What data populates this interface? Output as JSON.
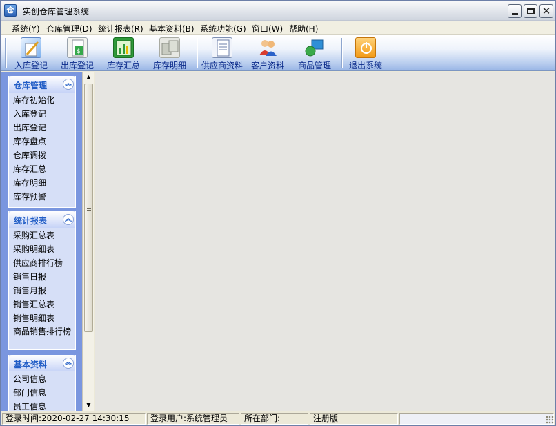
{
  "window": {
    "title": "实创仓库管理系统",
    "icon": "warehouse-app-icon"
  },
  "menu": [
    {
      "label": "系统(Y)"
    },
    {
      "label": "仓库管理(D)"
    },
    {
      "label": "统计报表(R)"
    },
    {
      "label": "基本资料(B)"
    },
    {
      "label": "系统功能(G)"
    },
    {
      "label": "窗口(W)"
    },
    {
      "label": "帮助(H)"
    }
  ],
  "toolbar": [
    {
      "label": "入库登记",
      "icon": "stock-in-icon"
    },
    {
      "label": "出库登记",
      "icon": "stock-out-icon"
    },
    {
      "label": "库存汇总",
      "icon": "inventory-summary-icon"
    },
    {
      "label": "库存明细",
      "icon": "inventory-detail-icon"
    },
    {
      "label": "供应商资料",
      "icon": "supplier-icon"
    },
    {
      "label": "客户资料",
      "icon": "customer-icon"
    },
    {
      "label": "商品管理",
      "icon": "product-icon"
    },
    {
      "label": "退出系统",
      "icon": "exit-icon"
    }
  ],
  "sidebar": {
    "groups": [
      {
        "title": "仓库管理",
        "items": [
          "库存初始化",
          "入库登记",
          "出库登记",
          "库存盘点",
          "仓库调拨",
          "库存汇总",
          "库存明细",
          "库存预警"
        ]
      },
      {
        "title": "统计报表",
        "items": [
          "采购汇总表",
          "采购明细表",
          "供应商排行榜",
          "销售日报",
          "销售月报",
          "销售汇总表",
          "销售明细表",
          "商品销售排行榜"
        ]
      },
      {
        "title": "基本资料",
        "items": [
          "公司信息",
          "部门信息",
          "员工信息"
        ]
      }
    ]
  },
  "statusbar": {
    "login_time": "登录时间:2020-02-27 14:30:15",
    "login_user": "登录用户:系统管理员",
    "department": "所在部门:",
    "registration": "注册版",
    "extra": ""
  },
  "colors": {
    "toolbar_label": "#0a2a8a",
    "sidebar_bg": "#7a96df",
    "group_title": "#215dc6",
    "mdi_bg": "#e6e5e1"
  }
}
